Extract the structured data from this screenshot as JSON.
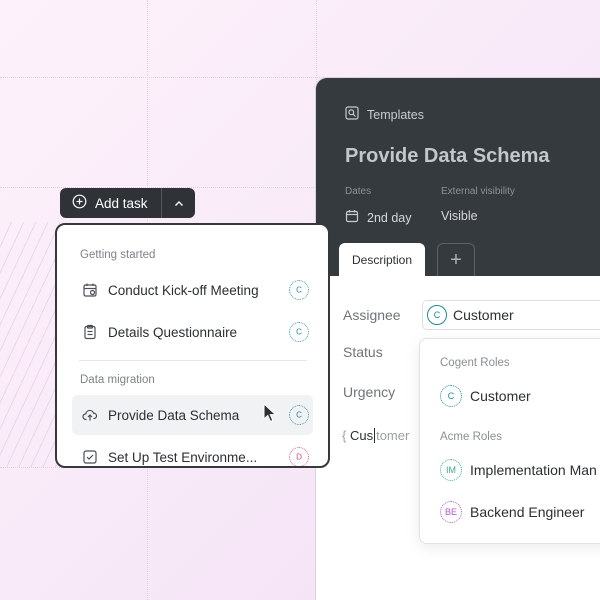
{
  "add_task": {
    "label": "Add task"
  },
  "task_menu": {
    "sections": [
      {
        "title": "Getting started",
        "items": [
          {
            "label": "Conduct Kick-off Meeting",
            "icon": "calendar-icon",
            "assignee": "C"
          },
          {
            "label": "Details Questionnaire",
            "icon": "clipboard-icon",
            "assignee": "C"
          }
        ]
      },
      {
        "title": "Data migration",
        "items": [
          {
            "label": "Provide Data Schema",
            "icon": "cloud-upload-icon",
            "assignee": "C"
          },
          {
            "label": "Set Up Test Environme...",
            "icon": "checkbox-icon",
            "assignee": "D"
          }
        ]
      }
    ]
  },
  "panel": {
    "breadcrumb": "Templates",
    "title": "Provide Data Schema",
    "meta": {
      "dates_label": "Dates",
      "dates_value": "2nd day",
      "visibility_label": "External visibility",
      "visibility_value": "Visible"
    },
    "tabs": {
      "description": "Description",
      "add": "+"
    },
    "fields": {
      "assignee_label": "Assignee",
      "assignee_value": "Customer",
      "assignee_avatar": "C",
      "status_label": "Status",
      "urgency_label": "Urgency"
    },
    "search": {
      "typed": "Cus",
      "suggestion": "tomer",
      "bracket": "{"
    }
  },
  "roles_dropdown": {
    "groups": [
      {
        "title": "Cogent Roles",
        "items": [
          {
            "label": "Customer",
            "avatar": "C"
          }
        ]
      },
      {
        "title": "Acme Roles",
        "items": [
          {
            "label": "Implementation Man",
            "avatar": "IM"
          },
          {
            "label": "Backend Engineer",
            "avatar": "BE"
          }
        ]
      }
    ]
  },
  "colors": {
    "background": "#f8eaf8",
    "panel_dark": "#353a3e",
    "button_dark": "#2f3337",
    "avatar_customer": "#1d8a9c",
    "avatar_d": "#e0407e",
    "avatar_im": "#3aa89a",
    "avatar_be": "#b553d6"
  }
}
